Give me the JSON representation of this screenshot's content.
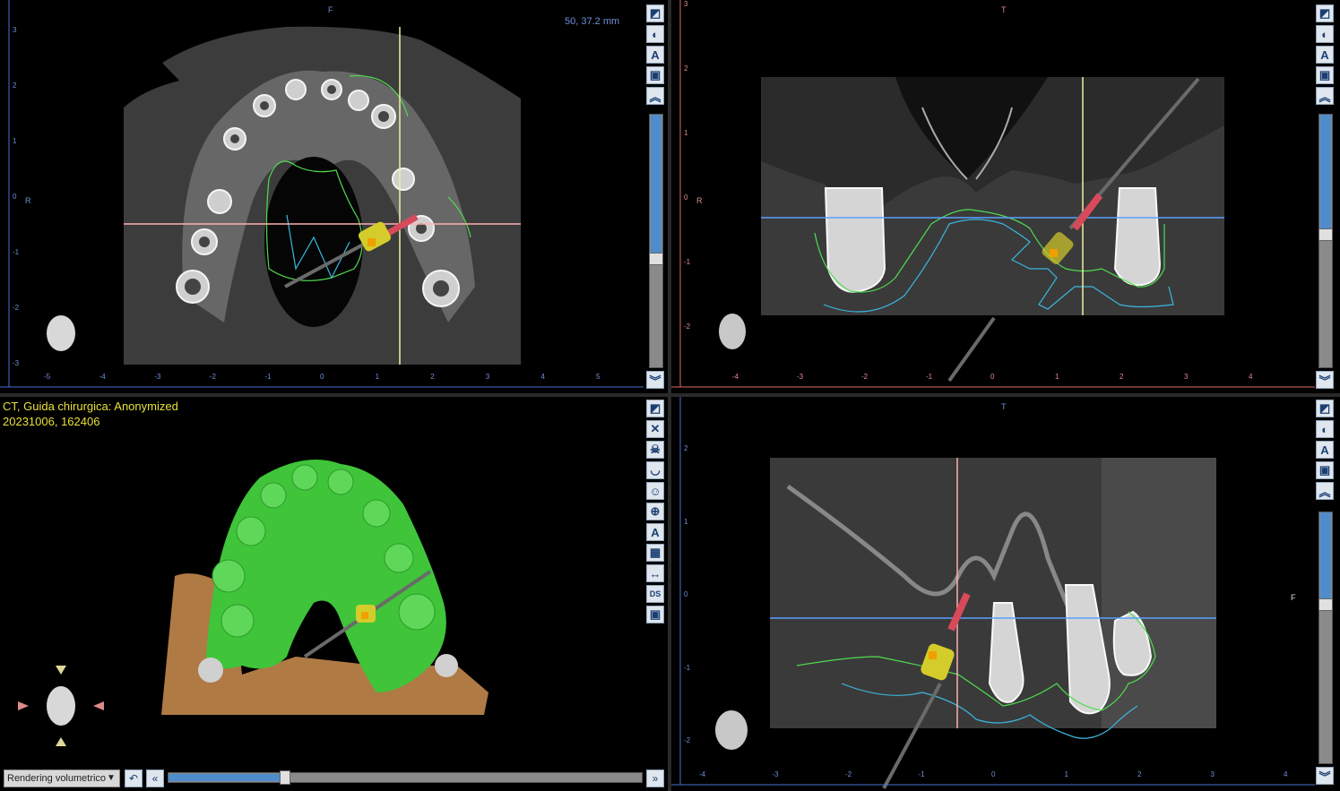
{
  "top_left": {
    "orientation_top": "F",
    "orientation_left": "R",
    "measure": "50, 37.2 mm",
    "x_ticks": [
      "-5",
      "-4",
      "-3",
      "-2",
      "-1",
      "0",
      "1",
      "2",
      "3",
      "4",
      "5"
    ],
    "y_ticks": [
      "3",
      "2",
      "1",
      "0",
      "-1",
      "-2",
      "-3"
    ],
    "slider_fraction": 0.57
  },
  "top_right": {
    "orientation_top": "T",
    "orientation_left": "R",
    "x_ticks": [
      "-4",
      "-3",
      "-2",
      "-1",
      "0",
      "1",
      "2",
      "3",
      "4"
    ],
    "y_ticks": [
      "3",
      "2",
      "1",
      "0",
      "-1",
      "-2"
    ],
    "slider_fraction": 0.47
  },
  "bottom_left": {
    "info_line1": "CT, Guida chirurgica: Anonymized",
    "info_line2": "20231006, 162406",
    "render_mode": "Rendering volumetrico",
    "slider_fraction": 0.24
  },
  "bottom_right": {
    "orientation_top": "T",
    "orientation_right": "F",
    "x_ticks": [
      "-4",
      "-3",
      "-2",
      "-1",
      "0",
      "1",
      "2",
      "3",
      "4"
    ],
    "y_ticks": [
      "2",
      "1",
      "0",
      "-1",
      "-2"
    ],
    "slider_fraction": 0.36
  },
  "toolbar_icons": {
    "reset": "reset-icon",
    "contrast": "contrast-icon",
    "annotation": "A",
    "camera": "camera-icon",
    "scroll_up": "chevron-up-icon",
    "scroll_down": "chevron-down-icon",
    "skull": "skull-icon",
    "face": "face-icon",
    "ds": "DS",
    "measure": "measure-icon",
    "grid": "grid-icon",
    "cut": "cut-icon",
    "orient": "orient-icon",
    "arch": "arch-icon"
  },
  "colors": {
    "axis_blue": "#4a6fd0",
    "axis_red": "#d86a6a",
    "cursor_yellow": "#f0f0a0",
    "cursor_red": "#ffb0b0",
    "cursor_blue": "#5aa0ff",
    "contour_green": "#4fdc4f",
    "contour_cyan": "#3ab8e0",
    "model_green": "#3fc43a",
    "slider_fill": "#4f8ccc",
    "implant_yellow": "#d4cc2a",
    "implant_red": "#d84a5a"
  }
}
